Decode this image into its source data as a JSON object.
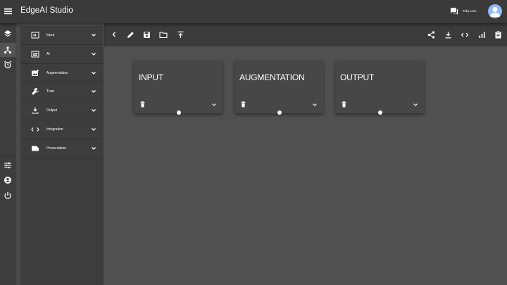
{
  "app": {
    "title": "EdgeAI Studio"
  },
  "user": {
    "name": "Toby Lam"
  },
  "rail": {
    "top": [
      {
        "icon": "layers-icon"
      },
      {
        "icon": "pipeline-icon",
        "active": true
      },
      {
        "icon": "alarm-clock-icon"
      }
    ],
    "bottom": [
      {
        "icon": "sliders-icon"
      },
      {
        "icon": "account-icon"
      },
      {
        "icon": "power-icon"
      }
    ]
  },
  "sidebar": {
    "items": [
      {
        "label": "Input",
        "icon": "input-icon"
      },
      {
        "label": "AI",
        "icon": "ai-chip-icon"
      },
      {
        "label": "Augmentation",
        "icon": "image-icon"
      },
      {
        "label": "Train",
        "icon": "wrench-icon"
      },
      {
        "label": "Output",
        "icon": "download-icon"
      },
      {
        "label": "Integration",
        "icon": "code-arrows-icon"
      },
      {
        "label": "Presentation",
        "icon": "slideshow-icon"
      }
    ]
  },
  "toolbar": {
    "left": [
      "back-icon",
      "edit-icon",
      "save-icon",
      "folder-icon",
      "upload-icon"
    ],
    "right": [
      "share-icon",
      "download-icon",
      "code-icon",
      "bar-chart-icon",
      "clipboard-icon"
    ]
  },
  "cards": [
    {
      "title": "INPUT"
    },
    {
      "title": "AUGMENTATION"
    },
    {
      "title": "OUTPUT"
    }
  ],
  "colors": {
    "topbar": "#3a3a3a",
    "sidebar": "#3d3d3d",
    "canvas": "#505050",
    "card": "#474747",
    "avatar": "#90b9f5"
  }
}
